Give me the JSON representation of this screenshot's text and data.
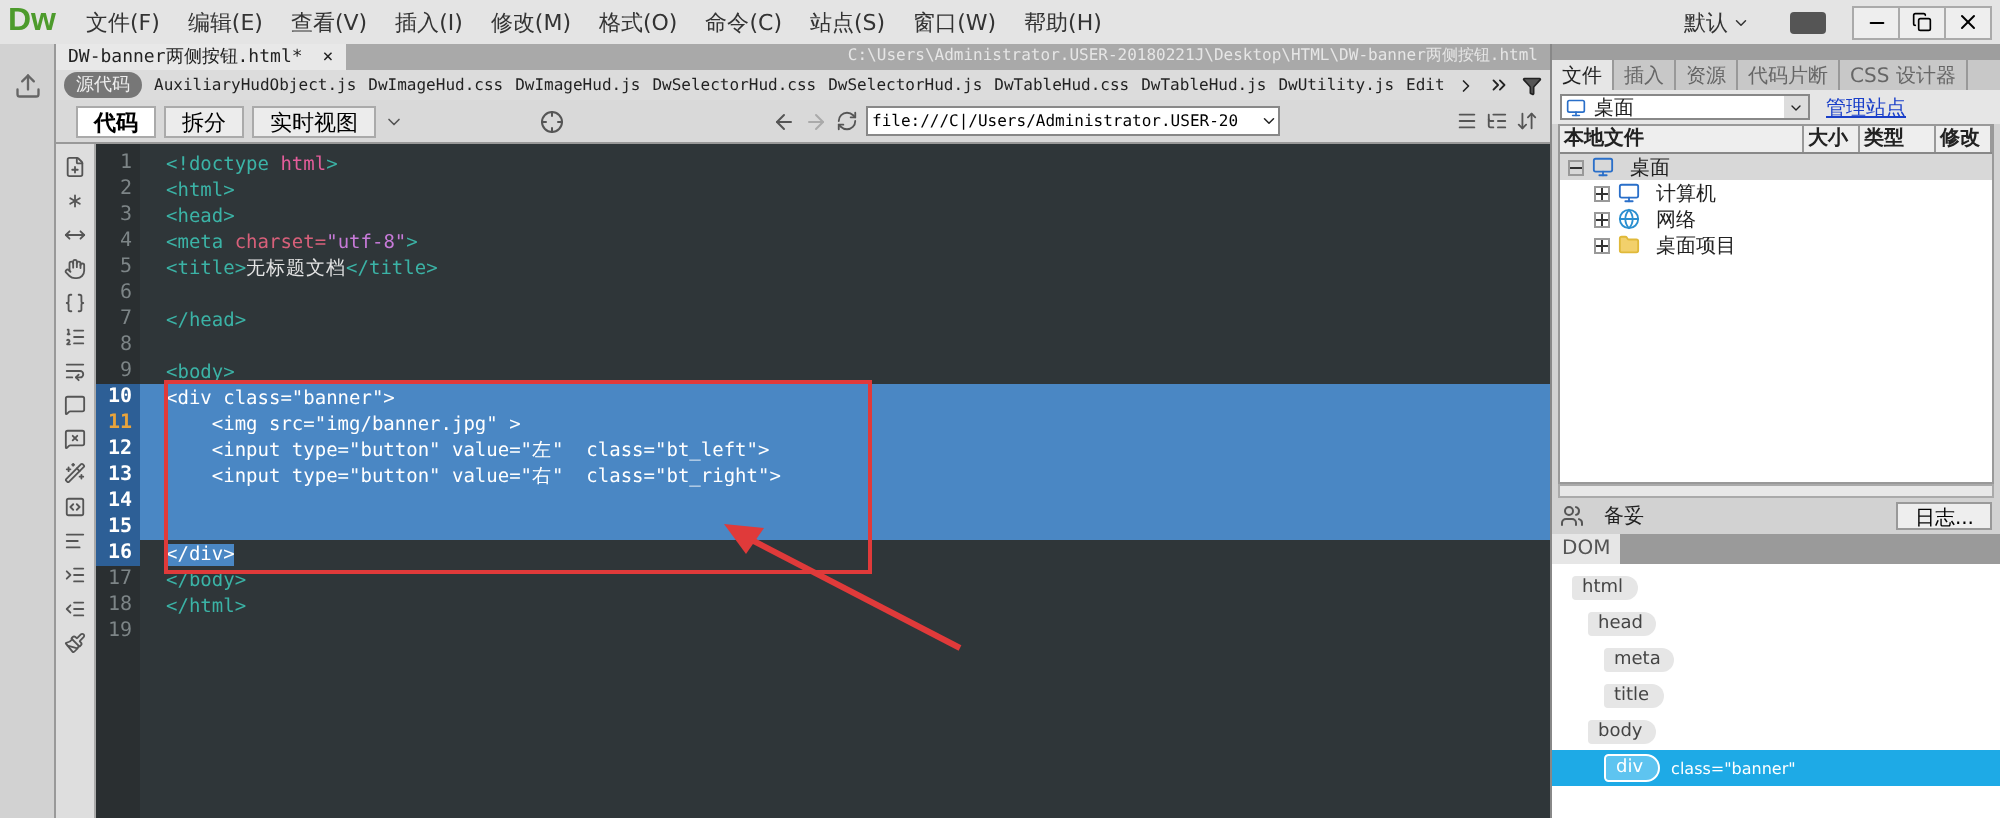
{
  "menu_bar": {
    "logo": "Dw",
    "menus": [
      "文件(F)",
      "编辑(E)",
      "查看(V)",
      "插入(I)",
      "修改(M)",
      "格式(O)",
      "命令(C)",
      "站点(S)",
      "窗口(W)",
      "帮助(H)"
    ],
    "workspace": "默认"
  },
  "document": {
    "tab": "DW-banner两侧按钮.html*",
    "close": "×",
    "path": "C:\\Users\\Administrator.USER-20180221J\\Desktop\\HTML\\DW-banner两侧按钮.html"
  },
  "related_files": {
    "source": "源代码",
    "files": [
      "AuxiliaryHudObject.js",
      "DwImageHud.css",
      "DwImageHud.js",
      "DwSelectorHud.css",
      "DwSelectorHud.js",
      "DwTableHud.css",
      "DwTableHud.js",
      "DwUtility.js",
      "Edit"
    ]
  },
  "view_buttons": [
    {
      "label": "代码",
      "selected": true
    },
    {
      "label": "拆分",
      "selected": false
    },
    {
      "label": "实时视图",
      "selected": false
    }
  ],
  "address": "file:///C|/Users/Administrator.USER-20",
  "code_lines": [
    {
      "number": "1",
      "selected": false,
      "current": false,
      "tokens": [
        {
          "kind": "tag",
          "text": "<!doctype "
        },
        {
          "kind": "keyword",
          "text": "html"
        },
        {
          "kind": "tag",
          "text": ">"
        }
      ]
    },
    {
      "number": "2",
      "selected": false,
      "current": false,
      "tokens": [
        {
          "kind": "tag",
          "text": "<html>"
        }
      ]
    },
    {
      "number": "3",
      "selected": false,
      "current": false,
      "tokens": [
        {
          "kind": "tag",
          "text": "<head>"
        }
      ]
    },
    {
      "number": "4",
      "selected": false,
      "current": false,
      "tokens": [
        {
          "kind": "tag",
          "text": "<meta "
        },
        {
          "kind": "attr",
          "text": "charset="
        },
        {
          "kind": "value",
          "text": "\"utf-8\""
        },
        {
          "kind": "tag",
          "text": ">"
        }
      ]
    },
    {
      "number": "5",
      "selected": false,
      "current": false,
      "tokens": [
        {
          "kind": "tag",
          "text": "<title>"
        },
        {
          "kind": "text",
          "text": "无标题文档"
        },
        {
          "kind": "tag",
          "text": "</title>"
        }
      ]
    },
    {
      "number": "6",
      "selected": false,
      "current": false
    },
    {
      "number": "7",
      "selected": false,
      "current": false,
      "tokens": [
        {
          "kind": "tag",
          "text": "</head>"
        }
      ]
    },
    {
      "number": "8",
      "selected": false,
      "current": false
    },
    {
      "number": "9",
      "selected": false,
      "current": false,
      "tokens": [
        {
          "kind": "tag",
          "text": "<body>"
        }
      ]
    },
    {
      "number": "10",
      "selected": true,
      "whole_line": true,
      "current": false,
      "text": "<div class=\"banner\">"
    },
    {
      "number": "11",
      "selected": true,
      "whole_line": true,
      "current": true,
      "text": "    <img src=\"img/banner.jpg\" >"
    },
    {
      "number": "12",
      "selected": true,
      "whole_line": true,
      "current": false,
      "text": "    <input type=\"button\" value=\"左\"  class=\"bt_left\">"
    },
    {
      "number": "13",
      "selected": true,
      "whole_line": true,
      "current": false,
      "text": "    <input type=\"button\" value=\"右\"  class=\"bt_right\">"
    },
    {
      "number": "14",
      "selected": true,
      "whole_line": true,
      "current": false
    },
    {
      "number": "15",
      "selected": true,
      "whole_line": true,
      "current": false
    },
    {
      "number": "16",
      "selected": true,
      "whole_line": false,
      "current": false,
      "text": "</div>"
    },
    {
      "number": "17",
      "selected": false,
      "current": false,
      "tokens": [
        {
          "kind": "tag",
          "text": "</body>"
        }
      ]
    },
    {
      "number": "18",
      "selected": false,
      "current": false,
      "tokens": [
        {
          "kind": "tag",
          "text": "</html>"
        }
      ]
    },
    {
      "number": "19",
      "selected": false,
      "current": false
    }
  ],
  "files_panel": {
    "tabs": [
      {
        "label": "文件",
        "selected": true
      },
      {
        "label": "插入",
        "selected": false
      },
      {
        "label": "资源",
        "selected": false
      },
      {
        "label": "代码片断",
        "selected": false
      },
      {
        "label": "CSS 设计器",
        "selected": false
      }
    ],
    "site": "桌面",
    "manage_link": "管理站点",
    "columns": [
      "本地文件",
      "大小",
      "类型",
      "修改"
    ],
    "tree": [
      {
        "label": "桌面",
        "kind": "desktop",
        "expanded": true,
        "selected": true,
        "children": [
          {
            "label": "计算机",
            "kind": "computer",
            "expanded": false,
            "selected": false
          },
          {
            "label": "网络",
            "kind": "network",
            "expanded": false,
            "selected": false
          },
          {
            "label": "桌面项目",
            "kind": "folder",
            "expanded": false,
            "selected": false
          }
        ]
      }
    ],
    "status": "备妥",
    "log_button": "日志..."
  },
  "dom_panel": {
    "tab": "DOM",
    "nodes": [
      {
        "tag": "html",
        "selected": false,
        "children": [
          {
            "tag": "head",
            "selected": false,
            "children": [
              {
                "tag": "meta",
                "selected": false
              },
              {
                "tag": "title",
                "selected": false
              }
            ]
          },
          {
            "tag": "body",
            "selected": false,
            "children": [
              {
                "tag": "div",
                "attrs": "class=\"banner\"",
                "selected": true
              }
            ]
          }
        ]
      }
    ]
  }
}
